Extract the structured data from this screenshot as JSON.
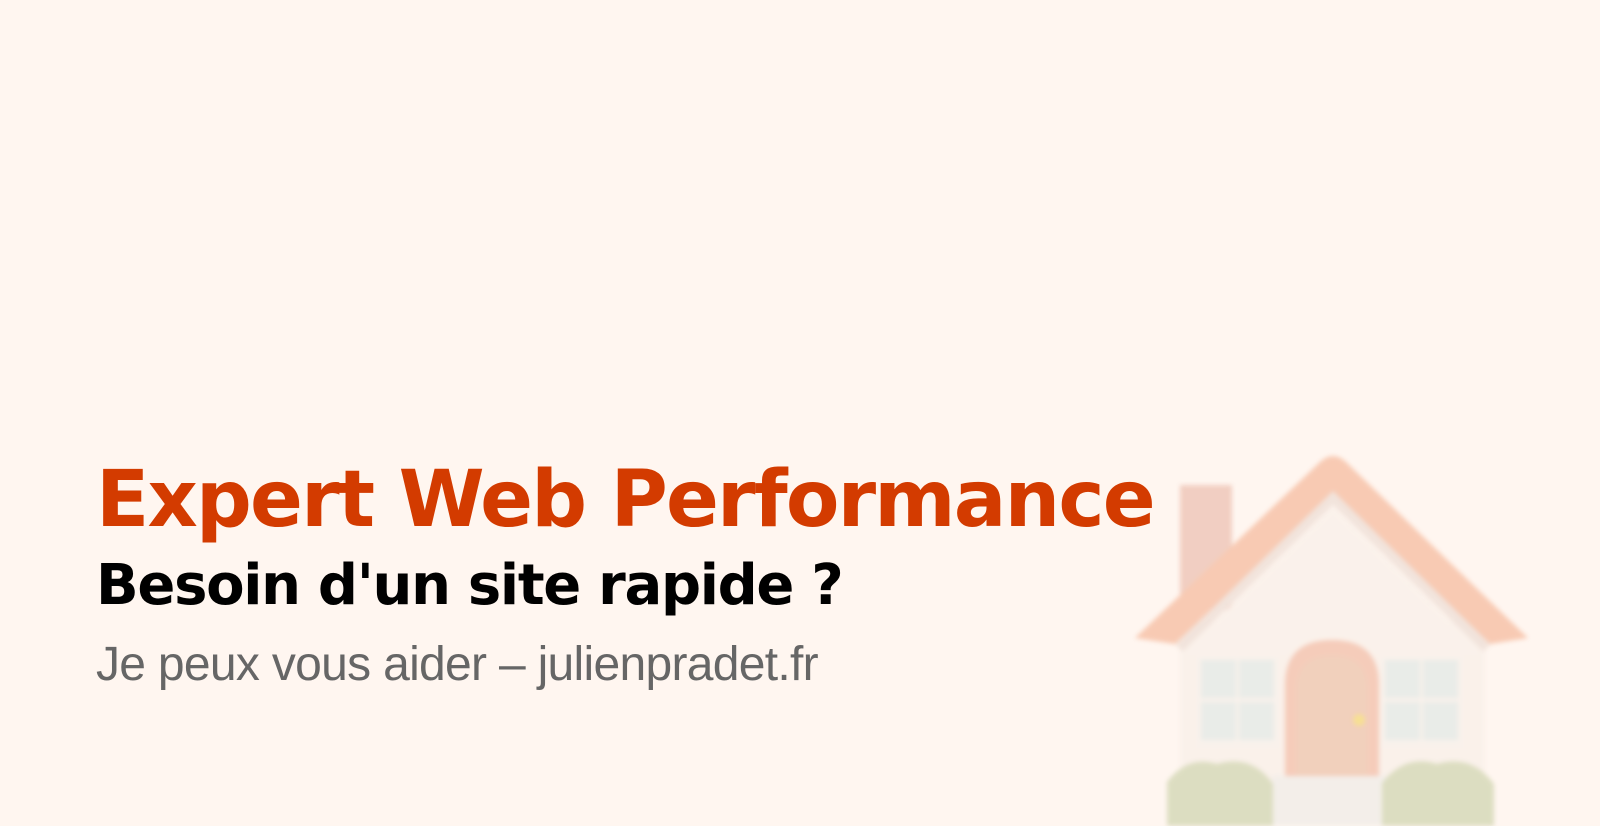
{
  "content": {
    "title": "Expert Web Performance",
    "subtitle": "Besoin d'un site rapide ?",
    "tagline": "Je peux vous aider – julienpradet.fr"
  },
  "colors": {
    "background": "#fff6f0",
    "title": "#d33b00",
    "subtitle": "#000000",
    "tagline": "#666666",
    "roof": "#f4b08f",
    "house_body": "#f7eee7",
    "window": "#dde7e4",
    "door": "#eab99d",
    "bush": "#c8cfa5"
  },
  "illustration": {
    "name": "house-illustration",
    "style": "blurred"
  }
}
